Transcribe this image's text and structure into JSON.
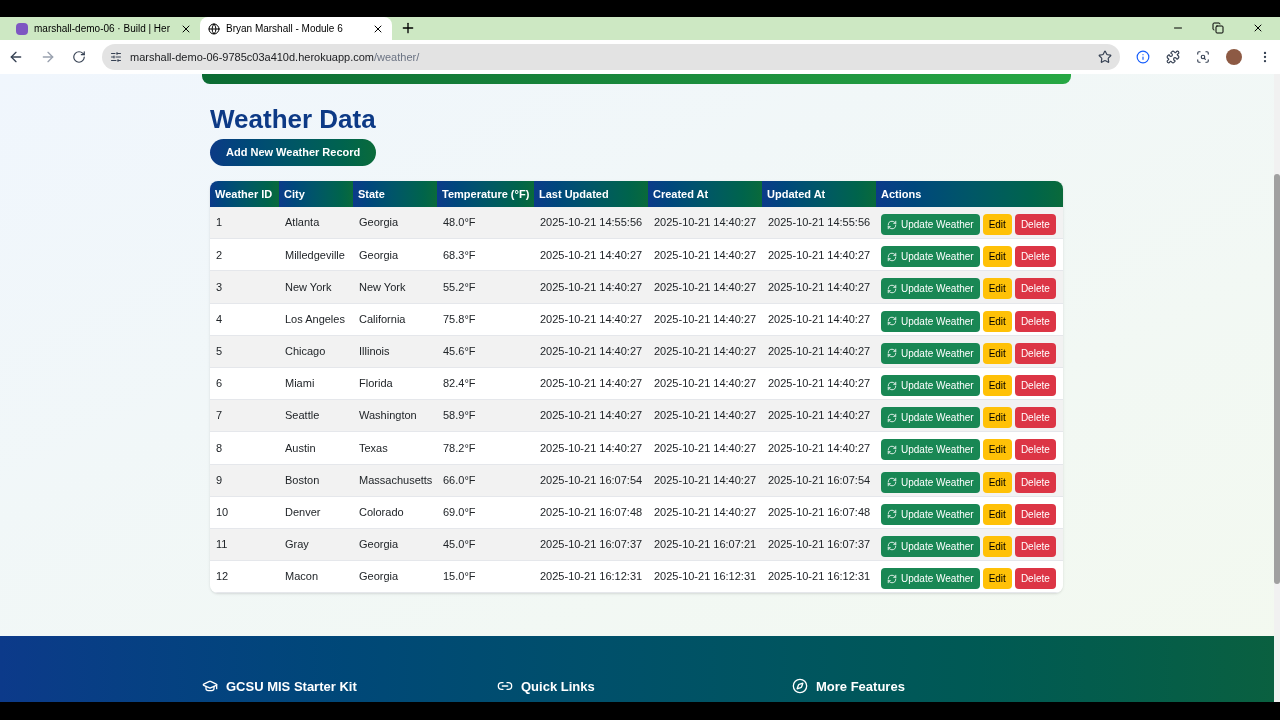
{
  "browser": {
    "tabs": [
      {
        "title": "marshall-demo-06 · Build | Her",
        "selected": false
      },
      {
        "title": "Bryan Marshall - Module 6",
        "selected": true
      }
    ],
    "url_host": "marshall-demo-06-9785c03a410d.herokuapp.com",
    "url_path": "/weather/"
  },
  "page": {
    "title": "Weather Data",
    "add_button": "Add New Weather Record",
    "table": {
      "columns": [
        "Weather ID",
        "City",
        "State",
        "Temperature (°F)",
        "Last Updated",
        "Created At",
        "Updated At",
        "Actions"
      ],
      "rows": [
        {
          "cells": [
            "1",
            "Atlanta",
            "Georgia",
            "48.0°F",
            "2025-10-21 14:55:56",
            "2025-10-21 14:40:27",
            "2025-10-21 14:55:56"
          ],
          "actions": [
            "Update Weather",
            "Edit",
            "Delete"
          ]
        },
        {
          "cells": [
            "2",
            "Milledgeville",
            "Georgia",
            "68.3°F",
            "2025-10-21 14:40:27",
            "2025-10-21 14:40:27",
            "2025-10-21 14:40:27"
          ],
          "actions": [
            "Update Weather",
            "Edit",
            "Delete"
          ]
        },
        {
          "cells": [
            "3",
            "New York",
            "New York",
            "55.2°F",
            "2025-10-21 14:40:27",
            "2025-10-21 14:40:27",
            "2025-10-21 14:40:27"
          ],
          "actions": [
            "Update Weather",
            "Edit",
            "Delete"
          ]
        },
        {
          "cells": [
            "4",
            "Los Angeles",
            "California",
            "75.8°F",
            "2025-10-21 14:40:27",
            "2025-10-21 14:40:27",
            "2025-10-21 14:40:27"
          ],
          "actions": [
            "Update Weather",
            "Edit",
            "Delete"
          ]
        },
        {
          "cells": [
            "5",
            "Chicago",
            "Illinois",
            "45.6°F",
            "2025-10-21 14:40:27",
            "2025-10-21 14:40:27",
            "2025-10-21 14:40:27"
          ],
          "actions": [
            "Update Weather",
            "Edit",
            "Delete"
          ]
        },
        {
          "cells": [
            "6",
            "Miami",
            "Florida",
            "82.4°F",
            "2025-10-21 14:40:27",
            "2025-10-21 14:40:27",
            "2025-10-21 14:40:27"
          ],
          "actions": [
            "Update Weather",
            "Edit",
            "Delete"
          ]
        },
        {
          "cells": [
            "7",
            "Seattle",
            "Washington",
            "58.9°F",
            "2025-10-21 14:40:27",
            "2025-10-21 14:40:27",
            "2025-10-21 14:40:27"
          ],
          "actions": [
            "Update Weather",
            "Edit",
            "Delete"
          ]
        },
        {
          "cells": [
            "8",
            "Austin",
            "Texas",
            "78.2°F",
            "2025-10-21 14:40:27",
            "2025-10-21 14:40:27",
            "2025-10-21 14:40:27"
          ],
          "actions": [
            "Update Weather",
            "Edit",
            "Delete"
          ]
        },
        {
          "cells": [
            "9",
            "Boston",
            "Massachusetts",
            "66.0°F",
            "2025-10-21 16:07:54",
            "2025-10-21 14:40:27",
            "2025-10-21 16:07:54"
          ],
          "actions": [
            "Update Weather",
            "Edit",
            "Delete"
          ]
        },
        {
          "cells": [
            "10",
            "Denver",
            "Colorado",
            "69.0°F",
            "2025-10-21 16:07:48",
            "2025-10-21 14:40:27",
            "2025-10-21 16:07:48"
          ],
          "actions": [
            "Update Weather",
            "Edit",
            "Delete"
          ]
        },
        {
          "cells": [
            "11",
            "Gray",
            "Georgia",
            "45.0°F",
            "2025-10-21 16:07:37",
            "2025-10-21 16:07:21",
            "2025-10-21 16:07:37"
          ],
          "actions": [
            "Update Weather",
            "Edit",
            "Delete"
          ]
        },
        {
          "cells": [
            "12",
            "Macon",
            "Georgia",
            "15.0°F",
            "2025-10-21 16:12:31",
            "2025-10-21 16:12:31",
            "2025-10-21 16:12:31"
          ],
          "actions": [
            "Update Weather",
            "Edit",
            "Delete"
          ]
        }
      ]
    }
  },
  "footer": {
    "sections": [
      "GCSU MIS Starter Kit",
      "Quick Links",
      "More Features"
    ]
  }
}
